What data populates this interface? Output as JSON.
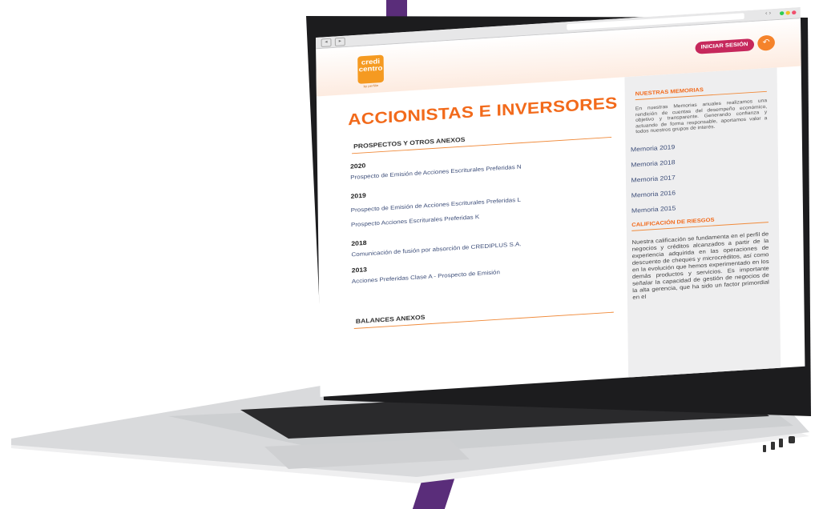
{
  "browser": {
    "nav_left": "◂",
    "nav_right": "▸",
    "arrows": "‹ ›"
  },
  "header": {
    "logo_text": "credi centro",
    "logo_sub": "by perfilin",
    "login_label": "INICIAR SESIÓN",
    "back_icon": "↶"
  },
  "main": {
    "page_title": "ACCIONISTAS E INVERSORES",
    "section_prospectos": "PROSPECTOS Y OTROS ANEXOS",
    "groups": [
      {
        "year": "2020",
        "links": [
          "Prospecto de Emisión de Acciones Escriturales Preferidas N"
        ]
      },
      {
        "year": "2019",
        "links": [
          "Prospecto de Emisión de Acciones Escriturales Preferidas L",
          "Prospecto Acciones Escriturales Preferidas K"
        ]
      },
      {
        "year": "2018",
        "links": [
          "Comunicación de fusión por absorción de CREDIPLUS S.A."
        ]
      },
      {
        "year": "2013",
        "links": [
          "Acciones Preferidas Clase A - Prospecto de Emisión"
        ]
      }
    ],
    "section_balances": "BALANCES ANEXOS"
  },
  "sidebar": {
    "memorias_title": "NUESTRAS MEMORIAS",
    "memorias_text": "En nuestras Memorias anuales realizamos una rendición de cuentas del desempeño económico, objetivo y transparente. Generando confianza y actuando de forma responsable, aportamos valor a todos nuestros grupos de interés.",
    "memorias": [
      "Memoria 2019",
      "Memoria 2018",
      "Memoria 2017",
      "Memoria 2016",
      "Memoria 2015"
    ],
    "riesgos_title": "CALIFICACIÓN DE RIESGOS",
    "riesgos_text": "Nuestra calificación se fundamenta en el perfil de negocios y créditos alcanzados a partir de la experiencia adquirida en las operaciones de descuento de cheques y microcréditos, así como en la evolución que hemos experimentado en los demás productos y servicios. Es importante señalar la capacidad de gestión de negocios de la alta gerencia, que ha sido un factor primordial en el"
  },
  "colors": {
    "accent_orange": "#f26a1b",
    "login_pink": "#c6285c",
    "link_blue": "#3e4f7a",
    "bg_purple": "#5a2d7a"
  }
}
